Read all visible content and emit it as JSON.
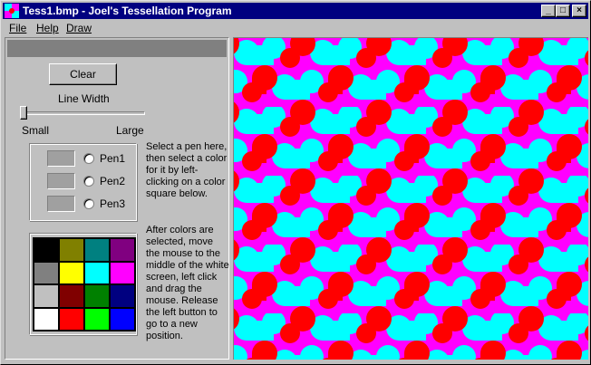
{
  "window": {
    "title": "Tess1.bmp - Joel's Tessellation Program",
    "controls": {
      "minimize": "_",
      "maximize": "□",
      "close": "×"
    }
  },
  "menu": [
    {
      "label": "File"
    },
    {
      "label": "Help"
    },
    {
      "label": "Draw"
    }
  ],
  "toolbar": {
    "clear_label": "Clear",
    "line_width_label": "Line Width",
    "small_label": "Small",
    "large_label": "Large",
    "line_width_value": 0
  },
  "pens": [
    {
      "label": "Pen1",
      "color": "#a0a0a0"
    },
    {
      "label": "Pen2",
      "color": "#a0a0a0"
    },
    {
      "label": "Pen3",
      "color": "#a0a0a0"
    }
  ],
  "instructions": {
    "select_pen": "Select a pen here, then select a color for it by left-clicking on a color square below.",
    "draw": "After colors are selected, move the mouse to the middle of the white screen, left click and drag the mouse. Release the left button to go to a new position."
  },
  "palette": [
    "#000000",
    "#808000",
    "#008080",
    "#800080",
    "#808080",
    "#ffff00",
    "#00ffff",
    "#ff00ff",
    "#c0c0c0",
    "#800000",
    "#008000",
    "#000080",
    "#ffffff",
    "#ff0000",
    "#00ff00",
    "#0000ff"
  ],
  "canvas": {
    "tile_colors": [
      "#ff00ff",
      "#00ffff",
      "#ff0000"
    ]
  }
}
